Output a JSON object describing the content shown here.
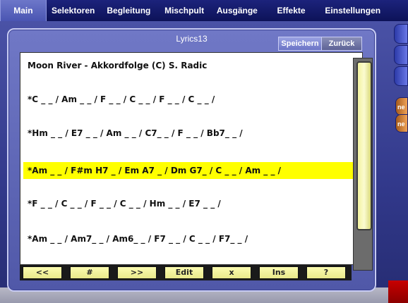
{
  "menu": {
    "items": [
      {
        "label": "Main",
        "active": true
      },
      {
        "label": "Selektoren",
        "active": false
      },
      {
        "label": "Begleitung",
        "active": false
      },
      {
        "label": "Mischpult",
        "active": false
      },
      {
        "label": "Ausgänge",
        "active": false
      },
      {
        "label": "Effekte",
        "active": false
      },
      {
        "label": "Einstellungen",
        "active": false
      }
    ]
  },
  "window": {
    "title": "Lyrics13",
    "save_label": "Speichern",
    "back_label": "Zurück"
  },
  "lyrics": {
    "lines": [
      "Moon River - Akkordfolge (C) S. Radic",
      "*C _ _ / Am _ _ / F _ _ / C _ _ / F _ _ / C _ _ /",
      "*Hm _ _ / E7 _ _ / Am _ _ / C7_ _ / F _ _ / Bb7_ _ /",
      "*Am _ _ / F#m H7 _ / Em A7 _ / Dm G7_ / C _ _ / Am _ _ /",
      "*F _ _ / C _ _ /  F _ _ / C _ _ / Hm _ _ / E7 _ _ /",
      "*Am _ _ / Am7_ _ / Am6_ _ / F7 _ _ / C _ _ / F7_ _ /"
    ],
    "highlighted_index": 3
  },
  "toolbar": {
    "buttons": [
      "<<",
      "#",
      ">>",
      "Edit",
      "x",
      "Ins",
      "?"
    ]
  },
  "side_tabs": {
    "labels": [
      "ne",
      "ne"
    ]
  },
  "colors": {
    "highlight": "#ffff00",
    "button_face": "#f4f4a0",
    "window_bg": "#5c64b4",
    "menu_bg": "#141a6a"
  }
}
